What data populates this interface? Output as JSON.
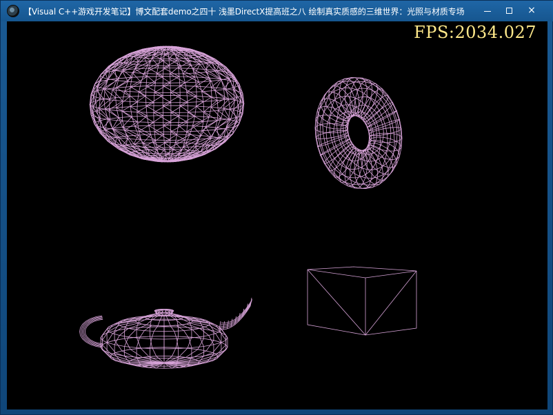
{
  "window": {
    "title": "【Visual C++游戏开发笔记】博文配套demo之四十 浅墨DirectX提高班之八 绘制真实质感的三维世界：光照与材质专场",
    "icon": "directx-app-icon",
    "buttons": {
      "minimize": "minimize-icon",
      "maximize": "maximize-icon",
      "close": "×"
    }
  },
  "viewport": {
    "background": "#000000",
    "wire_color": "#d7a3d8",
    "fps_color": "#ffe98a",
    "fps_text": "FPS:2034.027",
    "meshes": [
      "sphere-wireframe",
      "torus-wireframe",
      "teapot-wireframe",
      "box-wireframe"
    ]
  }
}
